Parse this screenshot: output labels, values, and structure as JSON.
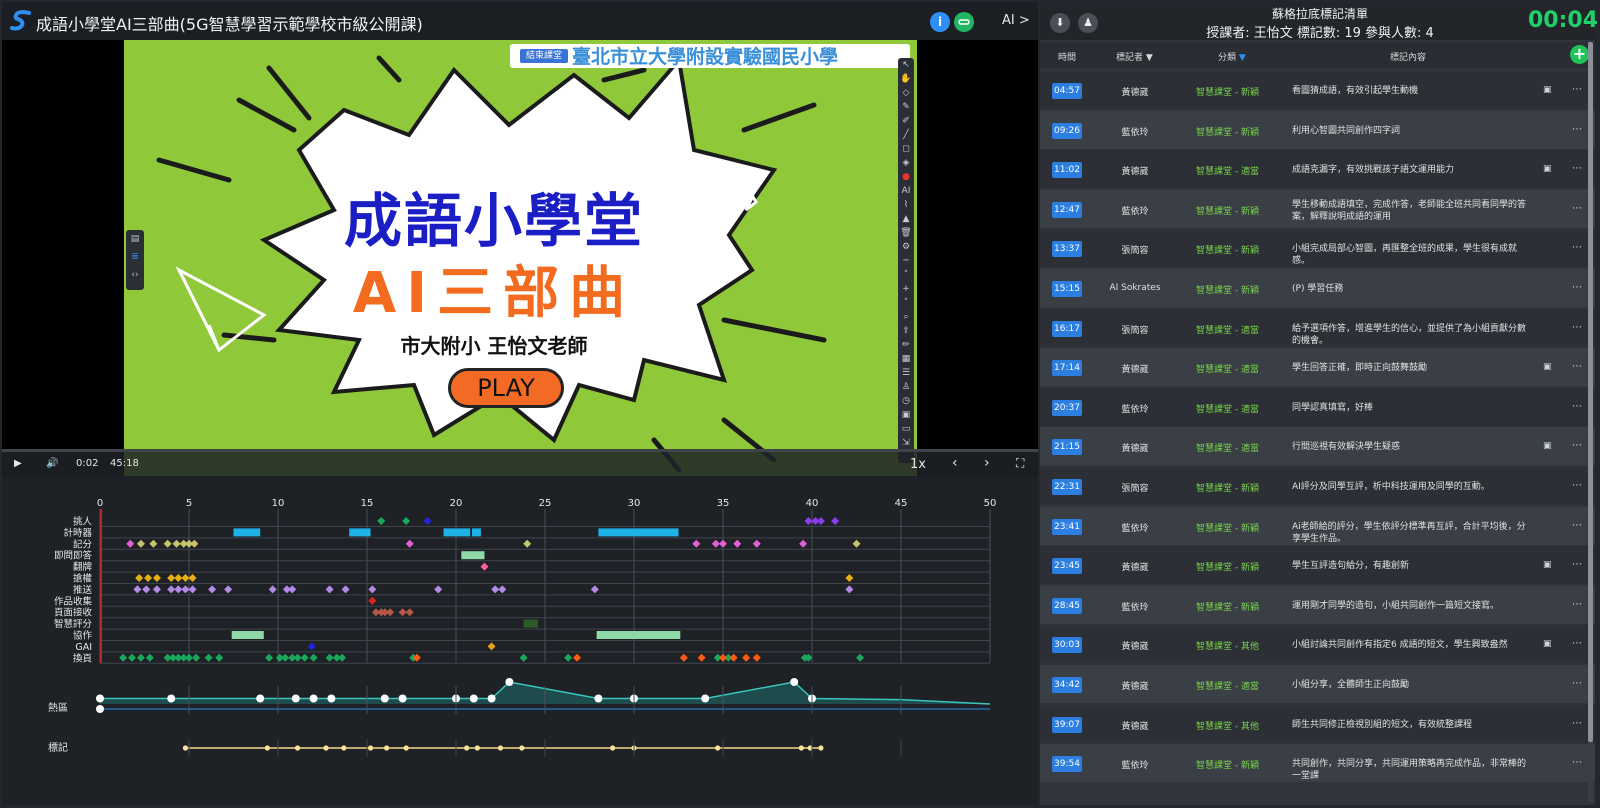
{
  "header": {
    "title": "成語小學堂AI三部曲(5G智慧學習示範學校市級公開課)",
    "info_icon": "info-icon",
    "link_icon": "link-icon",
    "ai_toggle": "AI >"
  },
  "slide": {
    "title1": "成語小學堂",
    "title2": "AI三部曲",
    "subtitle": "市大附小 王怡文老師",
    "play_label": "PLAY",
    "end_class": "結束課堂",
    "school": "臺北市立大學附設實驗國民小學"
  },
  "player": {
    "current": "0:02",
    "duration": "45:18",
    "speed": "1x",
    "progress": 0.0,
    "icons": [
      "play-icon",
      "volume-icon",
      "prev-icon",
      "next-icon",
      "fullscreen-icon"
    ]
  },
  "timeline": {
    "x_ticks": [
      0,
      5,
      10,
      15,
      20,
      25,
      30,
      35,
      40,
      45,
      50
    ],
    "xlim": [
      0,
      50
    ],
    "categories": [
      "挑人",
      "計時器",
      "記分",
      "即問即答",
      "翻牌",
      "搶權",
      "推送",
      "作品收集",
      "頁面接收",
      "智慧評分",
      "協作",
      "GAI",
      "換頁"
    ],
    "bars": [
      {
        "cat": "計時器",
        "start": 7.5,
        "end": 9.0,
        "color": "#1fb2e8"
      },
      {
        "cat": "計時器",
        "start": 14.0,
        "end": 15.2,
        "color": "#1fb2e8"
      },
      {
        "cat": "計時器",
        "start": 19.3,
        "end": 20.8,
        "color": "#1fb2e8"
      },
      {
        "cat": "計時器",
        "start": 20.9,
        "end": 21.4,
        "color": "#1fb2e8"
      },
      {
        "cat": "計時器",
        "start": 28.0,
        "end": 32.5,
        "color": "#1fb2e8"
      },
      {
        "cat": "即問即答",
        "start": 20.3,
        "end": 21.6,
        "color": "#8fd9a8"
      },
      {
        "cat": "智慧評分",
        "start": 23.8,
        "end": 24.6,
        "color": "#2f5a2a"
      },
      {
        "cat": "協作",
        "start": 7.4,
        "end": 9.2,
        "color": "#8fd9a8"
      },
      {
        "cat": "協作",
        "start": 27.9,
        "end": 32.6,
        "color": "#8fd9a8"
      }
    ],
    "points": [
      {
        "cat": "挑人",
        "color": "#19a85a",
        "x": [
          15.8,
          17.2
        ]
      },
      {
        "cat": "挑人",
        "color": "#2222dd",
        "x": [
          18.4
        ]
      },
      {
        "cat": "挑人",
        "color": "#8a3cf0",
        "x": [
          39.8,
          40.2,
          40.5,
          41.3
        ]
      },
      {
        "cat": "記分",
        "color": "#e45fd3",
        "x": [
          1.7,
          17.4,
          33.5,
          34.6,
          35.0,
          35.8,
          36.9,
          39.5
        ]
      },
      {
        "cat": "記分",
        "color": "#c6c46a",
        "x": [
          2.3,
          3.0,
          3.8,
          4.3,
          4.7,
          5.0,
          5.3,
          24.0,
          42.5
        ]
      },
      {
        "cat": "翻牌",
        "color": "#ff5f9a",
        "x": [
          21.6
        ]
      },
      {
        "cat": "搶權",
        "color": "#e6b10f",
        "x": [
          2.2,
          2.7,
          3.2,
          4.0,
          4.4,
          4.8,
          5.2,
          42.1
        ]
      },
      {
        "cat": "推送",
        "color": "#b48ae8",
        "x": [
          2.1,
          2.6,
          3.2,
          4.0,
          4.4,
          4.8,
          5.2,
          6.3,
          7.2,
          9.7,
          10.5,
          10.8,
          12.9,
          13.8,
          15.3,
          19.0,
          22.2,
          22.6,
          27.8,
          42.1
        ]
      },
      {
        "cat": "作品收集",
        "color": "#e02222",
        "x": [
          15.3
        ]
      },
      {
        "cat": "頁面接收",
        "color": "#b5584a",
        "x": [
          15.5,
          15.8,
          16.0,
          16.3,
          17.0,
          17.4
        ]
      },
      {
        "cat": "GAI",
        "color": "#2222dd",
        "x": [
          11.9
        ]
      },
      {
        "cat": "GAI",
        "color": "#e6a21a",
        "x": [
          22.0
        ]
      },
      {
        "cat": "換頁",
        "color": "#19a85a",
        "x": [
          1.3,
          1.8,
          2.3,
          2.8,
          3.8,
          4.1,
          4.4,
          4.7,
          5.0,
          5.4,
          6.1,
          6.7,
          9.5,
          10.1,
          10.4,
          10.8,
          11.1,
          11.5,
          12.0,
          12.9,
          13.3,
          13.6,
          17.6,
          23.8,
          26.3,
          34.7,
          35.3,
          39.6,
          39.8,
          42.7
        ]
      },
      {
        "cat": "換頁",
        "color": "#ff5a14",
        "x": [
          17.8,
          26.8,
          32.8,
          33.8,
          35.0,
          35.6,
          36.3,
          36.9
        ]
      }
    ],
    "heat_label": "熱區",
    "heat_series": [
      {
        "x": 0,
        "y": 0.25
      },
      {
        "x": 4,
        "y": 0.25
      },
      {
        "x": 9,
        "y": 0.25
      },
      {
        "x": 11,
        "y": 0.25
      },
      {
        "x": 12,
        "y": 0.25
      },
      {
        "x": 13,
        "y": 0.25
      },
      {
        "x": 16,
        "y": 0.25
      },
      {
        "x": 17,
        "y": 0.25
      },
      {
        "x": 20,
        "y": 0.25
      },
      {
        "x": 21,
        "y": 0.25
      },
      {
        "x": 22,
        "y": 0.25
      },
      {
        "x": 23,
        "y": 1.0
      },
      {
        "x": 28,
        "y": 0.25
      },
      {
        "x": 30,
        "y": 0.25
      },
      {
        "x": 34,
        "y": 0.25
      },
      {
        "x": 39,
        "y": 1.0
      },
      {
        "x": 40,
        "y": 0.25
      },
      {
        "x": 45,
        "y": 0.2
      },
      {
        "x": 50,
        "y": 0.0
      }
    ],
    "heat_markers": [
      0,
      4,
      9,
      11,
      12,
      13,
      16,
      17,
      20,
      21,
      22,
      23,
      28,
      30,
      34,
      39,
      40
    ],
    "mark_label": "標記",
    "mark_points": [
      4.8,
      9.4,
      11.1,
      12.7,
      13.7,
      15.2,
      16.1,
      17.2,
      20.6,
      21.2,
      22.5,
      23.7,
      28.8,
      30.0,
      34.7,
      39.4,
      39.9,
      40.5
    ]
  },
  "panel": {
    "title": "蘇格拉底標記清單",
    "subtitle": "授課者: 王怡文 標記數: 19 參與人數: 4",
    "timer": "00:04",
    "download_icon": "download-icon",
    "upload_icon": "upload-icon",
    "add_icon": "add-icon",
    "columns": {
      "time": "時間",
      "marker": "標記者",
      "category": "分類",
      "content": "標記內容"
    },
    "rows": [
      {
        "time": "04:57",
        "who": "黃德崴",
        "cat": "智慧課堂 - 新穎",
        "text": "看圖猜成語，有效引起學生動機",
        "img": true
      },
      {
        "time": "09:26",
        "who": "藍依玲",
        "cat": "智慧課堂 - 新穎",
        "text": "利用心智圖共同創作四字詞",
        "img": false
      },
      {
        "time": "11:02",
        "who": "黃德崴",
        "cat": "智慧課堂 - 適當",
        "text": "成語克漏字，有效挑戰孩子語文運用能力",
        "img": true
      },
      {
        "time": "12:47",
        "who": "藍依玲",
        "cat": "智慧課堂 - 新穎",
        "text": "學生移動成語填空，完成作答，老師能全班共同看同學的答案，解釋說明成語的運用",
        "img": false
      },
      {
        "time": "13:37",
        "who": "張簡容",
        "cat": "智慧課堂 - 新穎",
        "text": "小組完成局部心智圖，再匯整全班的成果，學生很有成就感。",
        "img": false
      },
      {
        "time": "15:15",
        "who": "AI Sokrates",
        "cat": "智慧課堂 - 新穎",
        "text": "(P) 學習任務",
        "img": false
      },
      {
        "time": "16:17",
        "who": "張簡容",
        "cat": "智慧課堂 - 適當",
        "text": "給予選項作答，增進學生的信心，並提供了為小組貢獻分數的機會。",
        "img": false
      },
      {
        "time": "17:14",
        "who": "黃德崴",
        "cat": "智慧課堂 - 適當",
        "text": "學生回答正確，即時正向鼓舞鼓勵",
        "img": true
      },
      {
        "time": "20:37",
        "who": "藍依玲",
        "cat": "智慧課堂 - 適當",
        "text": "同學認真填寫，好棒",
        "img": false
      },
      {
        "time": "21:15",
        "who": "黃德崴",
        "cat": "智慧課堂 - 適當",
        "text": "行間巡視有效解決學生疑惑",
        "img": true
      },
      {
        "time": "22:31",
        "who": "張簡容",
        "cat": "智慧課堂 - 新穎",
        "text": "AI評分及同學互評，析中科技運用及同學的互動。",
        "img": false
      },
      {
        "time": "23:41",
        "who": "藍依玲",
        "cat": "智慧課堂 - 新穎",
        "text": "Ai老師給的評分，學生依評分標準再互評，合計平均後，分享學生作品。",
        "img": false
      },
      {
        "time": "23:45",
        "who": "黃德崴",
        "cat": "智慧課堂 - 新穎",
        "text": "學生互評造句給分，有趣創新",
        "img": true
      },
      {
        "time": "28:45",
        "who": "藍依玲",
        "cat": "智慧課堂 - 新穎",
        "text": "運用剛才同學的造句，小組共同創作一篇短文接寫。",
        "img": false
      },
      {
        "time": "30:03",
        "who": "黃德崴",
        "cat": "智慧課堂 - 其他",
        "text": "小組討論共同創作有指定6 成語的短文，學生興致盎然",
        "img": true
      },
      {
        "time": "34:42",
        "who": "黃德崴",
        "cat": "智慧課堂 - 適當",
        "text": "小組分享，全體師生正向鼓勵",
        "img": false
      },
      {
        "time": "39:07",
        "who": "黃德崴",
        "cat": "智慧課堂 - 其他",
        "text": "師生共同修正檢視別組的短文，有效統整課程",
        "img": false
      },
      {
        "time": "39:54",
        "who": "藍依玲",
        "cat": "智慧課堂 - 新穎",
        "text": "共同創作，共同分享，共同運用策略再完成作品，非常棒的一堂課",
        "img": false
      }
    ]
  }
}
